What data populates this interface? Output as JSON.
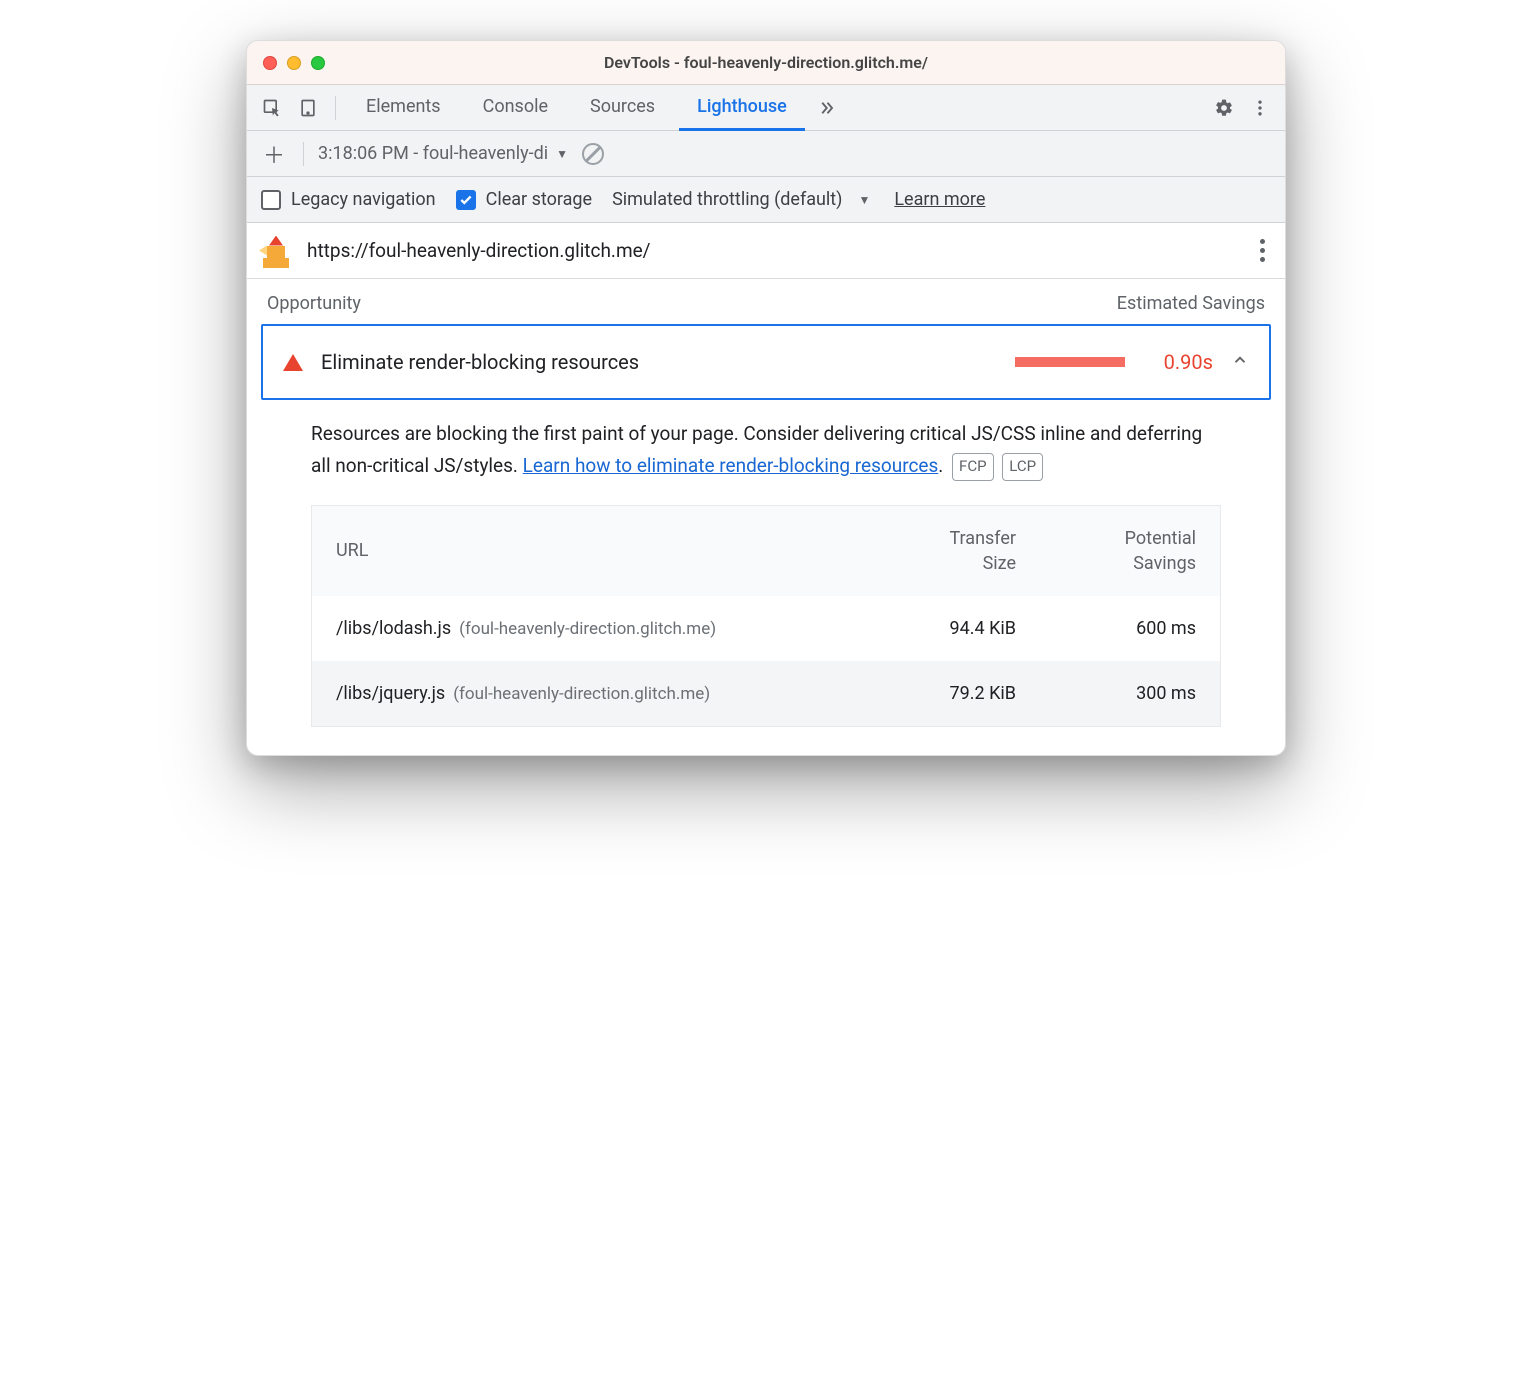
{
  "window": {
    "title": "DevTools - foul-heavenly-direction.glitch.me/"
  },
  "tabs": {
    "items": [
      "Elements",
      "Console",
      "Sources",
      "Lighthouse"
    ],
    "active": "Lighthouse"
  },
  "subbar": {
    "report_label": "3:18:06 PM - foul-heavenly-di"
  },
  "options": {
    "legacy_label": "Legacy navigation",
    "legacy_checked": false,
    "clear_label": "Clear storage",
    "clear_checked": true,
    "throttling_label": "Simulated throttling (default)",
    "learn_more": "Learn more"
  },
  "page": {
    "url": "https://foul-heavenly-direction.glitch.me/"
  },
  "section": {
    "opportunity": "Opportunity",
    "savings": "Estimated Savings"
  },
  "audit": {
    "title": "Eliminate render-blocking resources",
    "savings": "0.90s",
    "desc_part1": "Resources are blocking the first paint of your page. Consider delivering critical JS/CSS inline and deferring all non-critical JS/styles. ",
    "desc_link": "Learn how to eliminate render-blocking resources",
    "desc_dot": ".",
    "pills": [
      "FCP",
      "LCP"
    ]
  },
  "table": {
    "headers": {
      "url": "URL",
      "transfer": "Transfer\nSize",
      "potential": "Potential\nSavings"
    },
    "rows": [
      {
        "path": "/libs/lodash.js",
        "host": "(foul-heavenly-direction.glitch.me)",
        "size": "94.4 KiB",
        "savings": "600 ms"
      },
      {
        "path": "/libs/jquery.js",
        "host": "(foul-heavenly-direction.glitch.me)",
        "size": "79.2 KiB",
        "savings": "300 ms"
      }
    ]
  }
}
